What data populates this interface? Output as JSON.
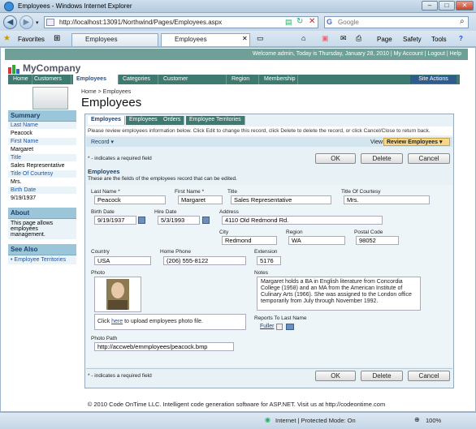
{
  "window": {
    "title": "Employees - Windows Internet Explorer",
    "min": "–",
    "max": "□",
    "close": "✕"
  },
  "address": {
    "url": "http://localhost:13091/Northwind/Pages/Employees.aspx",
    "search_placeholder": "Google"
  },
  "bar": {
    "favorites": "Favorites",
    "tab1": "Employees",
    "tab2": "Employees",
    "page": "Page",
    "safety": "Safety",
    "tools": "Tools",
    "help": "?"
  },
  "top": {
    "welcome": "Welcome admin, Today is Thursday, January 28, 2010 | My Account | Logout | Help"
  },
  "brand": "MyCompany",
  "menu": [
    "Home",
    "Customers",
    "Employees",
    "Categories",
    "Customer Demographics",
    "Region",
    "Membership"
  ],
  "site_actions": "Site Actions",
  "breadcrumb": "Home > Employees",
  "page_title": "Employees",
  "sidebar": {
    "summary": "Summary",
    "fields": [
      {
        "label": "Last Name",
        "value": "Peacock"
      },
      {
        "label": "First Name",
        "value": "Margaret"
      },
      {
        "label": "Title",
        "value": "Sales Representative"
      },
      {
        "label": "Title Of Courtesy",
        "value": "Mrs."
      },
      {
        "label": "Birth Date",
        "value": "9/19/1937"
      }
    ],
    "about": "About",
    "about_text": "This page allows employees management.",
    "see_also": "See Also",
    "see_also_link": "Employee Territories"
  },
  "form_tabs": [
    "Employees",
    "Employees",
    "Orders",
    "Employee Territories"
  ],
  "instructions": "Please review employees information below. Click Edit to change this record, click Delete to delete the record, or click Cancel/Close to return back.",
  "record": {
    "record_label": "Record",
    "view_label": "View:",
    "view_value": "Review Employees"
  },
  "buttons": {
    "ok": "OK",
    "delete": "Delete",
    "cancel": "Cancel"
  },
  "required_note": "* - indicates a required field",
  "section": {
    "title": "Employees",
    "desc": "These are the fields of the employees record that can be edited."
  },
  "fields": {
    "last_name_label": "Last Name *",
    "last_name": "Peacock",
    "first_name_label": "First Name *",
    "first_name": "Margaret",
    "title_label": "Title",
    "title": "Sales Representative",
    "toc_label": "Title Of Courtesy",
    "toc": "Mrs.",
    "birth_label": "Birth Date",
    "birth": "9/19/1937",
    "hire_label": "Hire Date",
    "hire": "5/3/1993",
    "address_label": "Address",
    "address": "4110 Old Redmond Rd.",
    "city_label": "City",
    "city": "Redmond",
    "region_label": "Region",
    "region": "WA",
    "postal_label": "Postal Code",
    "postal": "98052",
    "country_label": "Country",
    "country": "USA",
    "phone_label": "Home Phone",
    "phone": "(206) 555-8122",
    "ext_label": "Extension",
    "ext": "5176",
    "photo_label": "Photo",
    "notes_label": "Notes",
    "notes": "Margaret holds a BA in English literature from Concordia College (1958) and an MA from the American Institute of Culinary Arts (1966).  She was assigned to the London office temporarily from July through November 1992.",
    "upload_pre": "Click ",
    "upload_link": "here",
    "upload_post": " to upload employees photo file.",
    "reports_label": "Reports To Last Name",
    "reports": "Fuller",
    "path_label": "Photo Path",
    "path": "http://accweb/emmployees/peacock.bmp"
  },
  "footer": "© 2010 Code OnTime LLC. Intelligent code generation software for ASP.NET. Visit us at http://codeontime.com",
  "status": {
    "zone": "Internet | Protected Mode: On",
    "zoom": "100%"
  }
}
